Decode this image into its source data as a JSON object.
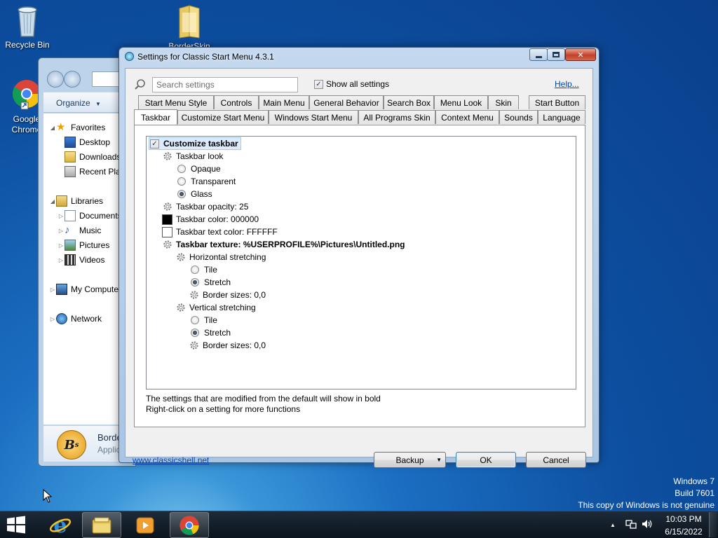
{
  "desktop": {
    "icons": [
      {
        "label": "Recycle Bin",
        "icon": "recycle-bin-icon"
      },
      {
        "label": "BorderSkin",
        "icon": "folder-icon"
      },
      {
        "label": "Google Chrome",
        "icon": "chrome-icon"
      }
    ],
    "watermark": {
      "line1": "Windows 7",
      "line2": "Build 7601",
      "line3": "This copy of Windows is not genuine"
    }
  },
  "explorer": {
    "toolbar": {
      "organize": "Organize"
    },
    "tree": [
      {
        "label": "Favorites",
        "icon": "star-icon"
      },
      {
        "label": "Desktop",
        "icon": "desktop-icon"
      },
      {
        "label": "Downloads",
        "icon": "downloads-icon"
      },
      {
        "label": "Recent Places",
        "icon": "recent-places-icon"
      },
      {
        "label": "Libraries",
        "icon": "libraries-icon"
      },
      {
        "label": "Documents",
        "icon": "documents-icon"
      },
      {
        "label": "Music",
        "icon": "music-icon"
      },
      {
        "label": "Pictures",
        "icon": "pictures-icon"
      },
      {
        "label": "Videos",
        "icon": "videos-icon"
      },
      {
        "label": "My Computer",
        "icon": "computer-icon"
      },
      {
        "label": "Network",
        "icon": "network-icon"
      }
    ],
    "details": {
      "name": "Border",
      "type": "Applic"
    }
  },
  "dialog": {
    "title": "Settings for Classic Start Menu 4.3.1",
    "search_placeholder": "Search settings",
    "show_all_label": "Show all settings",
    "show_all_checked": true,
    "help_label": "Help...",
    "tabs_row1": [
      "Start Menu Style",
      "Controls",
      "Main Menu",
      "General Behavior",
      "Search Box",
      "Menu Look",
      "Skin",
      "Start Button"
    ],
    "tabs_row2": [
      "Taskbar",
      "Customize Start Menu",
      "Windows Start Menu",
      "All Programs Skin",
      "Context Menu",
      "Sounds",
      "Language"
    ],
    "active_tab": "Taskbar",
    "settings": {
      "customize_taskbar": "Customize taskbar",
      "taskbar_look": "Taskbar look",
      "opaque": "Opaque",
      "transparent": "Transparent",
      "glass": "Glass",
      "opacity": "Taskbar opacity: 25",
      "color": "Taskbar color: 000000",
      "text_color": "Taskbar text color: FFFFFF",
      "texture": "Taskbar texture: %USERPROFILE%\\Pictures\\Untitled.png",
      "horizontal_stretching": "Horizontal stretching",
      "h_tile": "Tile",
      "h_stretch": "Stretch",
      "h_border": "Border sizes: 0,0",
      "vertical_stretching": "Vertical stretching",
      "v_tile": "Tile",
      "v_stretch": "Stretch",
      "v_border": "Border sizes: 0,0",
      "taskbar_color_hex": "#000000",
      "text_color_hex": "#FFFFFF"
    },
    "hint1": "The settings that are modified from the default will show in bold",
    "hint2": "Right-click on a setting for more functions",
    "website": "www.classicshell.net",
    "backup_label": "Backup",
    "ok_label": "OK",
    "cancel_label": "Cancel"
  },
  "taskbar": {
    "time": "10:03 PM",
    "date": "6/15/2022"
  }
}
